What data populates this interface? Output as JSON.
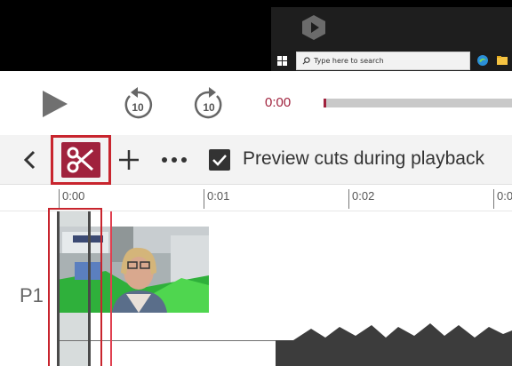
{
  "taskbar": {
    "search_placeholder": "Type here to search"
  },
  "player": {
    "current_time": "0:00",
    "progress": 0.01,
    "rewind_seconds": "10",
    "forward_seconds": "10"
  },
  "toolbar": {
    "preview_cuts_label": "Preview cuts during playback",
    "preview_cuts_checked": true
  },
  "timeline": {
    "ticks": [
      "0:00",
      "0:01",
      "0:02",
      "0:0"
    ],
    "track_label": "P1"
  },
  "colors": {
    "accent": "#a0223d",
    "highlight": "#c8252e"
  },
  "icons": [
    "app-logo-icon",
    "windows-start-icon",
    "search-icon",
    "edge-icon",
    "file-explorer-icon",
    "play-icon",
    "rewind-10-icon",
    "forward-10-icon",
    "chevron-left-icon",
    "scissors-icon",
    "plus-icon",
    "more-icon",
    "checkmark-icon"
  ]
}
